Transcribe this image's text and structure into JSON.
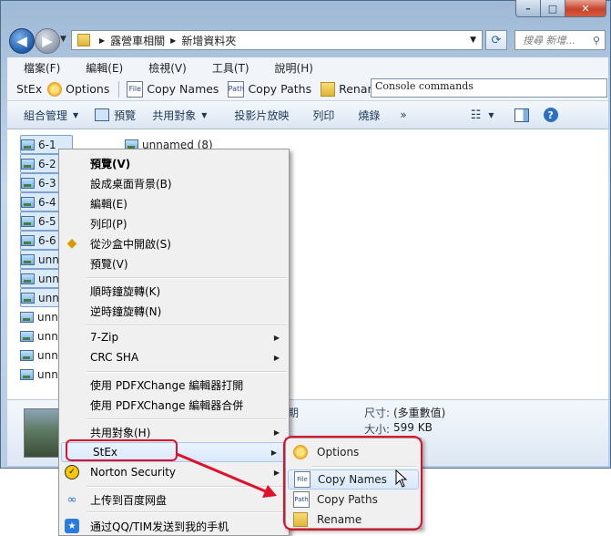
{
  "address": {
    "crumbs": [
      "露營車相關",
      "新增資料夾"
    ]
  },
  "search": {
    "placeholder": "搜尋 新增..."
  },
  "menubar": {
    "items": [
      "檔案(F)",
      "編輯(E)",
      "檢視(V)",
      "工具(T)",
      "說明(H)"
    ]
  },
  "stexbar": {
    "label": "StEx",
    "options": "Options",
    "copy_names": "Copy Names",
    "copy_paths": "Copy Paths",
    "rename": "Rename",
    "console_placeholder": "Console commands"
  },
  "cmdbar": {
    "organize": "組合管理",
    "preview": "預覽",
    "share": "共用對象",
    "slideshow": "投影片放映",
    "print": "列印",
    "burn": "燒錄",
    "more": "»"
  },
  "files": {
    "left": [
      "6-1",
      "6-2",
      "6-3",
      "6-4",
      "6-5",
      "6-6",
      "unn",
      "unn",
      "unn",
      "unn",
      "unn",
      "unn",
      "unn"
    ],
    "right": [
      "unnamed (8)"
    ]
  },
  "details": {
    "date_label": "期",
    "size_label": "尺寸:",
    "size_value": "(多重數值)",
    "filesize_label": "大小:",
    "filesize_value": "599 KB"
  },
  "context_menu": {
    "preview": "預覽(V)",
    "set_wallpaper": "設成桌面背景(B)",
    "edit": "編輯(E)",
    "print": "列印(P)",
    "sandbox_open": "從沙盒中開啟(S)",
    "preview2": "預覽(V)",
    "rotate_cw": "順時鐘旋轉(K)",
    "rotate_ccw": "逆時鐘旋轉(N)",
    "zip7": "7-Zip",
    "crc": "CRC SHA",
    "pdfx_open": "使用 PDFXChange 編輯器打開",
    "pdfx_merge": "使用 PDFXChange 編輯器合併",
    "share": "共用對象(H)",
    "stex": "StEx",
    "norton": "Norton Security",
    "baidu": "上传到百度网盘",
    "qq": "通过QQ/TIM发送到我的手机"
  },
  "submenu": {
    "options": "Options",
    "copy_names": "Copy Names",
    "copy_paths": "Copy Paths",
    "rename": "Rename"
  },
  "colors": {
    "annotation": "#e0102a",
    "accent": "#1d5aa8"
  }
}
